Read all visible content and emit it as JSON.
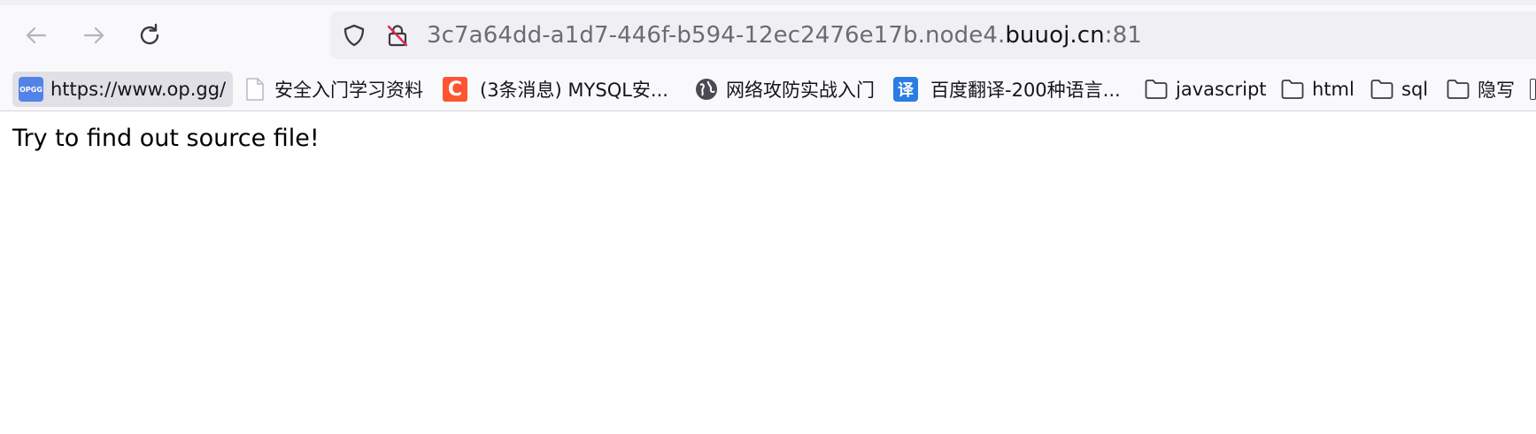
{
  "toolbar": {
    "back_icon": "back-arrow-icon",
    "forward_icon": "forward-arrow-icon",
    "reload_icon": "reload-icon"
  },
  "urlbar": {
    "url_prefix": "3c7a64dd-a1d7-446f-b594-12ec2476e17b.node4.",
    "url_domain": "buuoj.cn",
    "url_suffix": ":81",
    "shield_icon": "tracking-protection-shield-icon",
    "lock_icon": "insecure-connection-lock-icon"
  },
  "bookmarks": [
    {
      "label": "https://www.op.gg/",
      "icon": "opgg-favicon",
      "icon_text": "OPGG"
    },
    {
      "label": "安全入门学习资料",
      "icon": "page-icon"
    },
    {
      "label": "(3条消息) MYSQL安...",
      "icon": "csdn-favicon",
      "icon_text": "C"
    },
    {
      "label": "网络攻防实战入门",
      "icon": "globe-icon"
    },
    {
      "label": "百度翻译-200种语言...",
      "icon": "baidu-fanyi-favicon",
      "icon_text": "译"
    },
    {
      "label": "javascript",
      "icon": "folder-icon"
    },
    {
      "label": "html",
      "icon": "folder-icon"
    },
    {
      "label": "sql",
      "icon": "folder-icon"
    },
    {
      "label": "隐写",
      "icon": "folder-icon"
    }
  ],
  "page": {
    "body_text": "Try to find out source file!"
  },
  "colors": {
    "toolbar_bg": "#f9f9fb",
    "urlbar_bg": "#f0f0f4",
    "opgg_blue": "#5383e8",
    "csdn_red": "#fc5531",
    "fanyi_blue": "#2a7de1"
  }
}
